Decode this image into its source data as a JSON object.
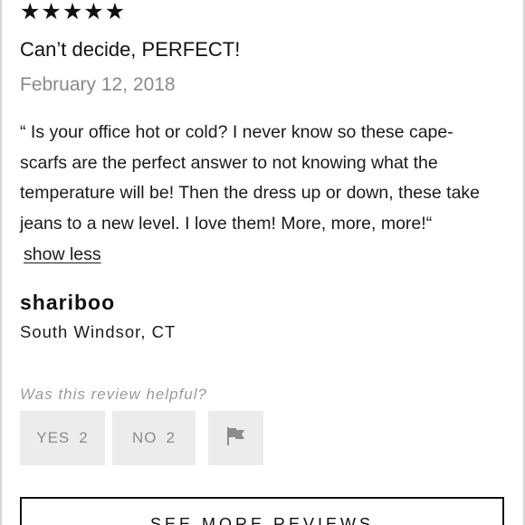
{
  "review": {
    "stars": [
      "★",
      "★",
      "★",
      "★",
      "★"
    ],
    "rating": 5,
    "title": "Can’t decide, PERFECT!",
    "date": "February 12, 2018",
    "body": "“ Is your office hot or cold? I never know so these cape-scarfs are the perfect answer to not knowing what the temperature will be! Then the dress up or down, these take jeans to a new level. I love them! More, more, more!“",
    "show_less_label": "show less"
  },
  "reviewer": {
    "username": "shariboo",
    "location": "South Windsor, CT"
  },
  "helpful": {
    "question": "Was this review helpful?",
    "yes_label": "YES",
    "yes_count": "2",
    "no_label": "NO",
    "no_count": "2",
    "flag_icon": "flag-icon"
  },
  "footer": {
    "see_more_label": "SEE MORE REVIEWS"
  }
}
